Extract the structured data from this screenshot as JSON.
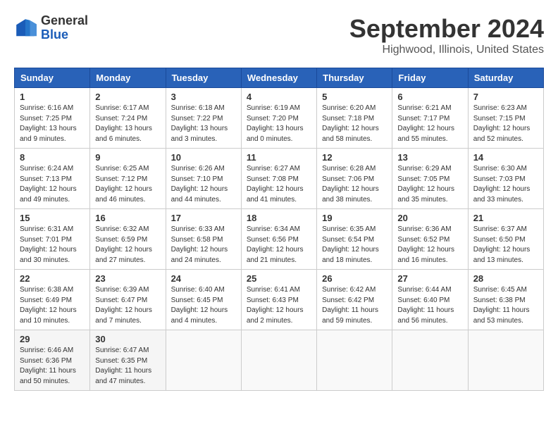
{
  "logo": {
    "general": "General",
    "blue": "Blue"
  },
  "title": {
    "month_year": "September 2024",
    "location": "Highwood, Illinois, United States"
  },
  "headers": [
    "Sunday",
    "Monday",
    "Tuesday",
    "Wednesday",
    "Thursday",
    "Friday",
    "Saturday"
  ],
  "weeks": [
    [
      {
        "day": "1",
        "info": "Sunrise: 6:16 AM\nSunset: 7:25 PM\nDaylight: 13 hours\nand 9 minutes."
      },
      {
        "day": "2",
        "info": "Sunrise: 6:17 AM\nSunset: 7:24 PM\nDaylight: 13 hours\nand 6 minutes."
      },
      {
        "day": "3",
        "info": "Sunrise: 6:18 AM\nSunset: 7:22 PM\nDaylight: 13 hours\nand 3 minutes."
      },
      {
        "day": "4",
        "info": "Sunrise: 6:19 AM\nSunset: 7:20 PM\nDaylight: 13 hours\nand 0 minutes."
      },
      {
        "day": "5",
        "info": "Sunrise: 6:20 AM\nSunset: 7:18 PM\nDaylight: 12 hours\nand 58 minutes."
      },
      {
        "day": "6",
        "info": "Sunrise: 6:21 AM\nSunset: 7:17 PM\nDaylight: 12 hours\nand 55 minutes."
      },
      {
        "day": "7",
        "info": "Sunrise: 6:23 AM\nSunset: 7:15 PM\nDaylight: 12 hours\nand 52 minutes."
      }
    ],
    [
      {
        "day": "8",
        "info": "Sunrise: 6:24 AM\nSunset: 7:13 PM\nDaylight: 12 hours\nand 49 minutes."
      },
      {
        "day": "9",
        "info": "Sunrise: 6:25 AM\nSunset: 7:12 PM\nDaylight: 12 hours\nand 46 minutes."
      },
      {
        "day": "10",
        "info": "Sunrise: 6:26 AM\nSunset: 7:10 PM\nDaylight: 12 hours\nand 44 minutes."
      },
      {
        "day": "11",
        "info": "Sunrise: 6:27 AM\nSunset: 7:08 PM\nDaylight: 12 hours\nand 41 minutes."
      },
      {
        "day": "12",
        "info": "Sunrise: 6:28 AM\nSunset: 7:06 PM\nDaylight: 12 hours\nand 38 minutes."
      },
      {
        "day": "13",
        "info": "Sunrise: 6:29 AM\nSunset: 7:05 PM\nDaylight: 12 hours\nand 35 minutes."
      },
      {
        "day": "14",
        "info": "Sunrise: 6:30 AM\nSunset: 7:03 PM\nDaylight: 12 hours\nand 33 minutes."
      }
    ],
    [
      {
        "day": "15",
        "info": "Sunrise: 6:31 AM\nSunset: 7:01 PM\nDaylight: 12 hours\nand 30 minutes."
      },
      {
        "day": "16",
        "info": "Sunrise: 6:32 AM\nSunset: 6:59 PM\nDaylight: 12 hours\nand 27 minutes."
      },
      {
        "day": "17",
        "info": "Sunrise: 6:33 AM\nSunset: 6:58 PM\nDaylight: 12 hours\nand 24 minutes."
      },
      {
        "day": "18",
        "info": "Sunrise: 6:34 AM\nSunset: 6:56 PM\nDaylight: 12 hours\nand 21 minutes."
      },
      {
        "day": "19",
        "info": "Sunrise: 6:35 AM\nSunset: 6:54 PM\nDaylight: 12 hours\nand 18 minutes."
      },
      {
        "day": "20",
        "info": "Sunrise: 6:36 AM\nSunset: 6:52 PM\nDaylight: 12 hours\nand 16 minutes."
      },
      {
        "day": "21",
        "info": "Sunrise: 6:37 AM\nSunset: 6:50 PM\nDaylight: 12 hours\nand 13 minutes."
      }
    ],
    [
      {
        "day": "22",
        "info": "Sunrise: 6:38 AM\nSunset: 6:49 PM\nDaylight: 12 hours\nand 10 minutes."
      },
      {
        "day": "23",
        "info": "Sunrise: 6:39 AM\nSunset: 6:47 PM\nDaylight: 12 hours\nand 7 minutes."
      },
      {
        "day": "24",
        "info": "Sunrise: 6:40 AM\nSunset: 6:45 PM\nDaylight: 12 hours\nand 4 minutes."
      },
      {
        "day": "25",
        "info": "Sunrise: 6:41 AM\nSunset: 6:43 PM\nDaylight: 12 hours\nand 2 minutes."
      },
      {
        "day": "26",
        "info": "Sunrise: 6:42 AM\nSunset: 6:42 PM\nDaylight: 11 hours\nand 59 minutes."
      },
      {
        "day": "27",
        "info": "Sunrise: 6:44 AM\nSunset: 6:40 PM\nDaylight: 11 hours\nand 56 minutes."
      },
      {
        "day": "28",
        "info": "Sunrise: 6:45 AM\nSunset: 6:38 PM\nDaylight: 11 hours\nand 53 minutes."
      }
    ],
    [
      {
        "day": "29",
        "info": "Sunrise: 6:46 AM\nSunset: 6:36 PM\nDaylight: 11 hours\nand 50 minutes."
      },
      {
        "day": "30",
        "info": "Sunrise: 6:47 AM\nSunset: 6:35 PM\nDaylight: 11 hours\nand 47 minutes."
      },
      {
        "day": "",
        "info": ""
      },
      {
        "day": "",
        "info": ""
      },
      {
        "day": "",
        "info": ""
      },
      {
        "day": "",
        "info": ""
      },
      {
        "day": "",
        "info": ""
      }
    ]
  ]
}
